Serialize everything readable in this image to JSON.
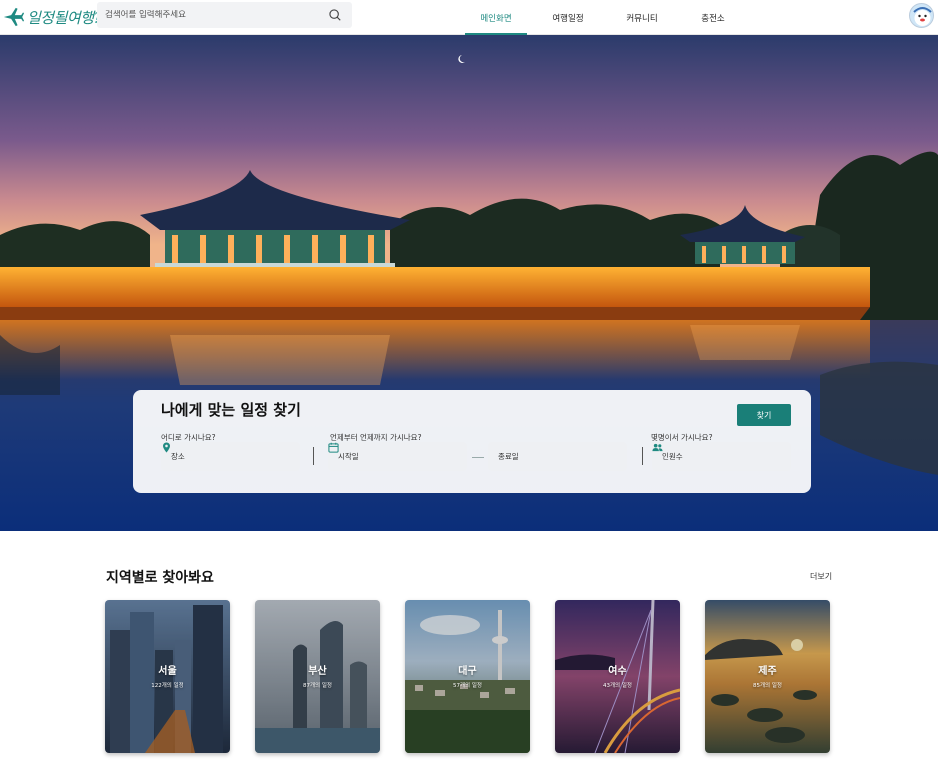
{
  "header": {
    "logo_text": "일정될여행",
    "logo_mark": "?",
    "search_placeholder": "검색어를 입력해주세요",
    "nav": [
      {
        "label": "메인화면",
        "active": true
      },
      {
        "label": "여행일정",
        "active": false
      },
      {
        "label": "커뮤니티",
        "active": false
      },
      {
        "label": "충전소",
        "active": false
      }
    ]
  },
  "finder": {
    "title": "나에게 맞는 일정 찾기",
    "button_label": "찾기",
    "where_label": "어디로 가시나요?",
    "where_value": "장소",
    "when_label": "언제부터 언제까지 가시나요?",
    "start_value": "시작일",
    "end_value": "종료일",
    "people_label": "몇명이서 가시나요?",
    "people_value": "인원수"
  },
  "regions": {
    "title": "지역별로 찾아봐요",
    "more_label": "더보기",
    "cards": [
      {
        "name": "서울",
        "count": "122개의 일정"
      },
      {
        "name": "부산",
        "count": "87개의 일정"
      },
      {
        "name": "대구",
        "count": "57개의 일정"
      },
      {
        "name": "여수",
        "count": "43개의 일정"
      },
      {
        "name": "제주",
        "count": "85개의 일정"
      }
    ]
  },
  "colors": {
    "accent": "#1f8a82",
    "button": "#1a7f78"
  }
}
